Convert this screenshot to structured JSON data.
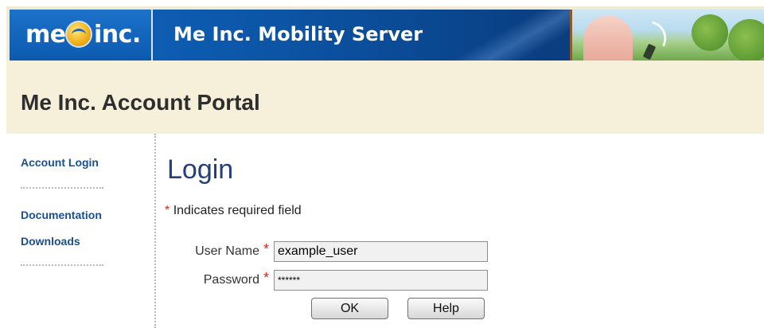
{
  "banner": {
    "logo_me": "me",
    "logo_inc": "inc.",
    "title": "Me Inc. Mobility Server"
  },
  "portal": {
    "title": "Me Inc. Account Portal"
  },
  "sidebar": {
    "items": [
      {
        "label": "Account Login"
      },
      {
        "label": "Documentation"
      },
      {
        "label": "Downloads"
      }
    ]
  },
  "login": {
    "title": "Login",
    "required_asterisk": "*",
    "required_note": "Indicates required field",
    "username_label": "User Name",
    "username_value": "example_user",
    "password_label": "Password",
    "password_value": "******",
    "ok_label": "OK",
    "help_label": "Help"
  },
  "colors": {
    "banner_blue": "#0a4f9d",
    "portal_bg": "#f6f0db",
    "link_blue": "#1b4f8f",
    "title_blue": "#243f7a",
    "required_red": "#c62b2b"
  },
  "icons": [
    "globe-logo-icon",
    "signal-icon",
    "phone-icon"
  ]
}
